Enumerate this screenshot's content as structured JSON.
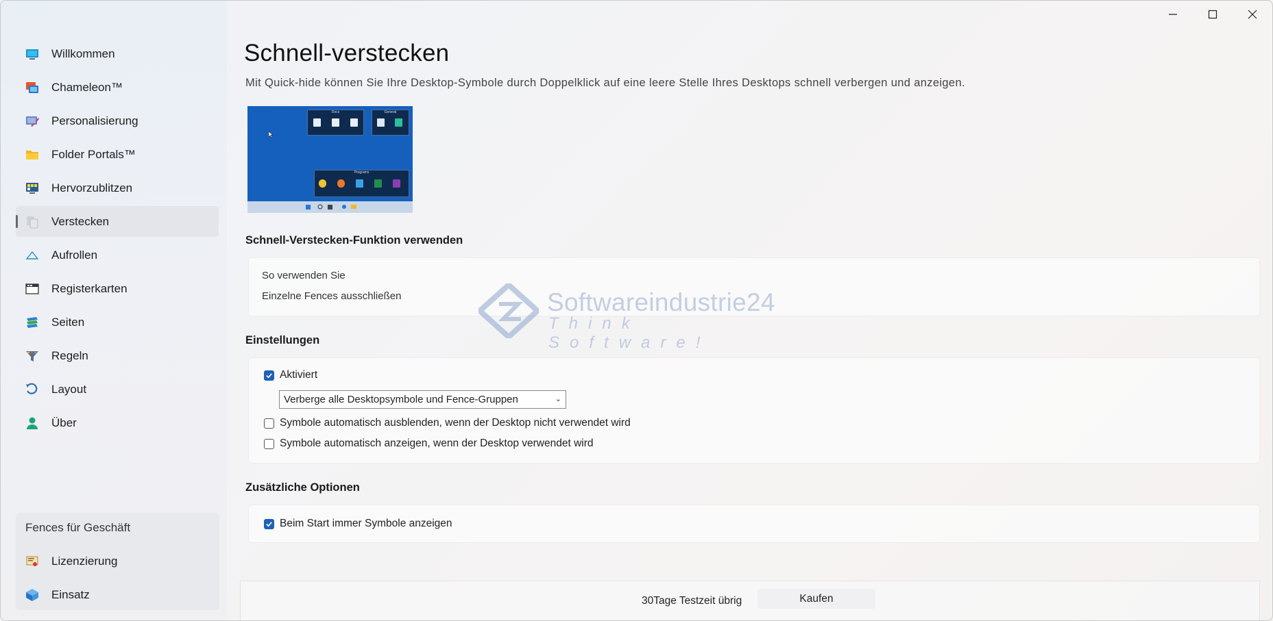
{
  "window": {
    "controls": [
      "minimize-icon",
      "maximize-icon",
      "close-icon"
    ]
  },
  "sidebar": {
    "items": [
      {
        "label": "Willkommen",
        "icon": "monitor-icon"
      },
      {
        "label": "Chameleon™",
        "icon": "chameleon-icon"
      },
      {
        "label": "Personalisierung",
        "icon": "paint-icon"
      },
      {
        "label": "Folder Portals™",
        "icon": "folder-icon"
      },
      {
        "label": "Hervorzublitzen",
        "icon": "highlight-icon"
      },
      {
        "label": "Verstecken",
        "icon": "hide-icon"
      },
      {
        "label": "Aufrollen",
        "icon": "rollup-icon"
      },
      {
        "label": "Registerkarten",
        "icon": "tabs-icon"
      },
      {
        "label": "Seiten",
        "icon": "pages-icon"
      },
      {
        "label": "Regeln",
        "icon": "filter-icon"
      },
      {
        "label": "Layout",
        "icon": "layout-icon"
      },
      {
        "label": "Über",
        "icon": "user-icon"
      }
    ],
    "active_index": 5,
    "business": {
      "title": "Fences für Geschäft",
      "items": [
        {
          "label": "Lizenzierung",
          "icon": "license-icon"
        },
        {
          "label": "Einsatz",
          "icon": "deploy-icon"
        }
      ]
    }
  },
  "main": {
    "title": "Schnell-verstecken",
    "description": "Mit Quick-hide können Sie Ihre Desktop-Symbole durch Doppelklick auf eine leere Stelle Ihres Desktops schnell verbergen und anzeigen.",
    "preview": {
      "fences": [
        "Docs",
        "General",
        "Programs"
      ]
    },
    "use_section": {
      "title": "Schnell-Verstecken-Funktion verwenden",
      "links": [
        "So verwenden Sie",
        "Einzelne Fences ausschließen"
      ]
    },
    "settings": {
      "title": "Einstellungen",
      "enabled_label": "Aktiviert",
      "enabled_checked": true,
      "dropdown_value": "Verberge alle Desktopsymbole und Fence-Gruppen",
      "auto_hide_label": "Symbole automatisch ausblenden, wenn der Desktop nicht verwendet wird",
      "auto_hide_checked": false,
      "auto_show_label": "Symbole automatisch anzeigen, wenn der Desktop verwendet wird",
      "auto_show_checked": false
    },
    "extra": {
      "title": "Zusätzliche Optionen",
      "always_show_label": "Beim Start immer Symbole anzeigen",
      "always_show_checked": true
    }
  },
  "footer": {
    "trial_text": "30Tage Testzeit übrig",
    "buy_label": "Kaufen"
  },
  "watermark": {
    "line1": "Softwareindustrie24",
    "line2": "Think Software!"
  },
  "colors": {
    "accent": "#1f61b8",
    "preview_bg": "#1560bd"
  }
}
